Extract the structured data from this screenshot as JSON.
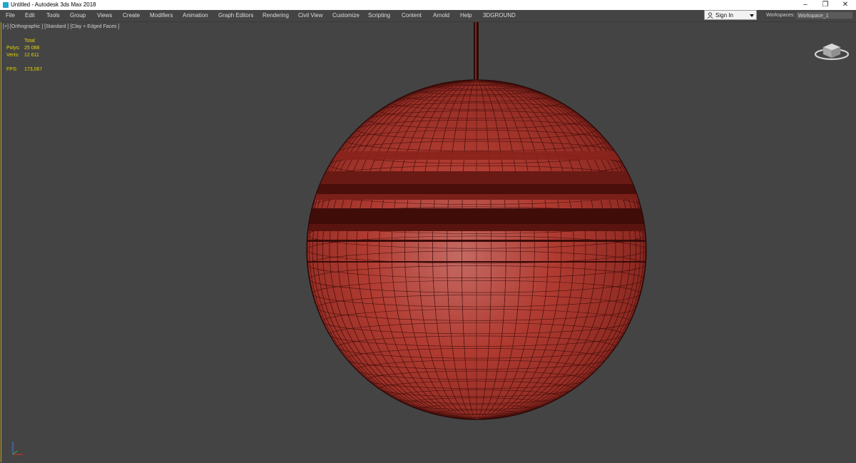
{
  "window": {
    "title": "Untitled - Autodesk 3ds Max 2018",
    "icon": "3dsmax-app-icon",
    "controls": [
      "minimize-icon",
      "restore-icon",
      "close-icon"
    ]
  },
  "menu": {
    "items": [
      "File",
      "Edit",
      "Tools",
      "Group",
      "Views",
      "Create",
      "Modifiers",
      "Animation",
      "Graph Editors",
      "Rendering",
      "Civil View",
      "Customize",
      "Scripting",
      "Content",
      "Arnold",
      "Help",
      "3DGROUND"
    ]
  },
  "account": {
    "sign_in": "Sign In",
    "icon": "user-icon"
  },
  "workspace": {
    "label": "Workspaces:",
    "value": "Workspace_1"
  },
  "viewport": {
    "label": "[+] [Orthographic ] [Standard ] [Clay + Edged Faces ]",
    "stats": {
      "header": "Total",
      "polys_label": "Polys:",
      "polys": "25 088",
      "verts_label": "Verts:",
      "verts": "12 611",
      "fps_label": "FPS:",
      "fps": "173,067"
    },
    "colors": {
      "background": "#444444",
      "sphere": "#b23a30",
      "wire": "#3a0b08",
      "active_border": "#c9a600",
      "stats_text": "#e3d500"
    },
    "icons": [
      "viewcube-icon",
      "axis-tripod-icon"
    ]
  }
}
